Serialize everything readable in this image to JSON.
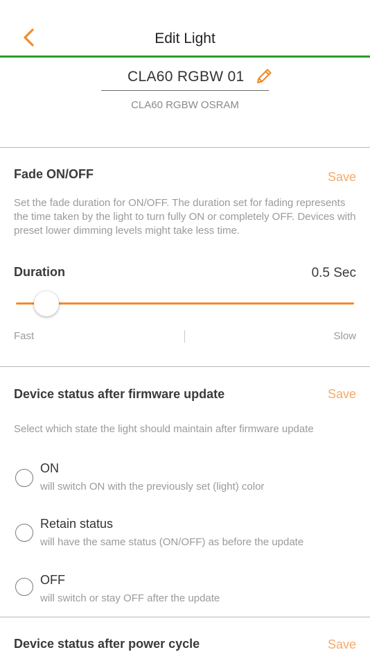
{
  "header": {
    "title": "Edit Light",
    "back_icon": "chevron-left-icon",
    "accent": "#f08c2c",
    "bar_color": "#2a9d2a"
  },
  "device": {
    "name": "CLA60 RGBW 01",
    "edit_icon": "pencil-icon",
    "model": "CLA60 RGBW OSRAM"
  },
  "fade": {
    "title": "Fade ON/OFF",
    "save_label": "Save",
    "description": "Set the fade duration for ON/OFF. The duration set for fading represents the time taken by the light to turn fully ON or completely OFF. Devices with preset lower dimming levels might take less time.",
    "duration_label": "Duration",
    "duration_value": "0.5 Sec",
    "slider_position_fraction": 0.09,
    "min_label": "Fast",
    "max_label": "Slow"
  },
  "firmware": {
    "title": "Device status after firmware update",
    "save_label": "Save",
    "description": "Select which state the light should maintain after firmware update",
    "options": [
      {
        "label": "ON",
        "sub": "will switch ON with the previously set (light) color",
        "selected": false
      },
      {
        "label": "Retain status",
        "sub": "will have the same status (ON/OFF) as before the update",
        "selected": false
      },
      {
        "label": "OFF",
        "sub": "will switch or stay OFF after the update",
        "selected": false
      }
    ]
  },
  "power": {
    "title": "Device status after power cycle",
    "save_label": "Save"
  }
}
